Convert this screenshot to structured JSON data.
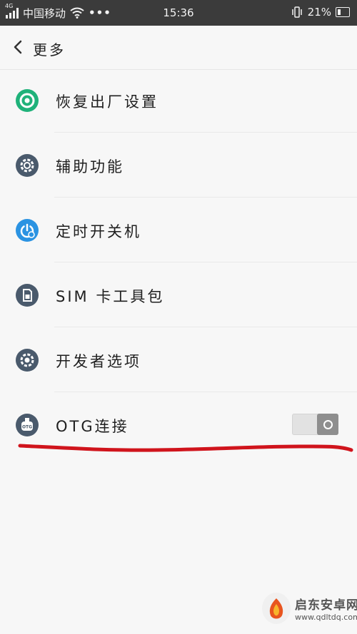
{
  "status_bar": {
    "network": "4G",
    "carrier": "中国移动",
    "dots": "•••",
    "time": "15:36",
    "battery_percent": "21%",
    "battery_level": 0.21,
    "icons": [
      "signal-icon",
      "wifi-icon",
      "vibrate-icon",
      "battery-icon"
    ]
  },
  "header": {
    "back_icon": "chevron-left-icon",
    "title": "更多"
  },
  "menu": {
    "items": [
      {
        "label": "恢复出厂设置",
        "icon": "factory-reset-icon"
      },
      {
        "label": "辅助功能",
        "icon": "accessibility-gear-icon"
      },
      {
        "label": "定时开关机",
        "icon": "scheduled-power-icon"
      },
      {
        "label": "SIM 卡工具包",
        "icon": "sim-card-icon"
      },
      {
        "label": "开发者选项",
        "icon": "developer-gear-icon"
      },
      {
        "label": "OTG连接",
        "icon": "otg-icon",
        "toggle": false
      }
    ]
  },
  "colors": {
    "status_bar_bg": "#3b3b3b",
    "green_icon": "#1fb27a",
    "slate_icon": "#4a5a6c",
    "blue_icon": "#2b93e2",
    "annotation_red": "#d0141c"
  },
  "watermark": {
    "name": "启东安卓网",
    "url": "www.qdltdq.com"
  }
}
